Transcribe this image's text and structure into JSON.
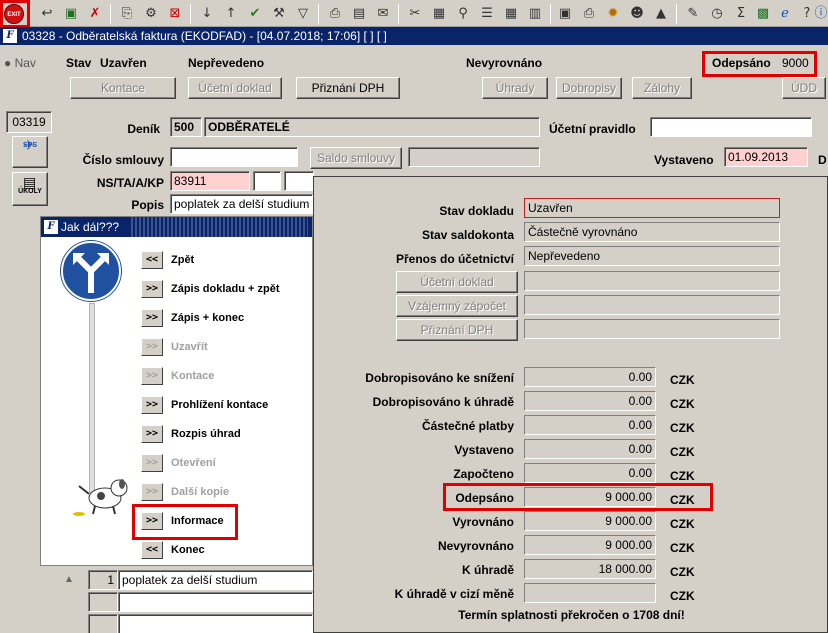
{
  "toolbar": {
    "exit_label": "EXIT",
    "icons": [
      "back-icon",
      "save-icon",
      "delete-icon",
      "copy-icon",
      "settings-icon",
      "cancel-icon",
      "sort-asc-icon",
      "sort-desc-icon",
      "check-icon",
      "wrench-icon",
      "filter-icon",
      "print-icon",
      "print-preview-icon",
      "mail-icon",
      "cut-icon",
      "paste-icon",
      "zoom-icon",
      "list-icon",
      "grid-icon",
      "calculator-icon",
      "document-icon",
      "print-small-icon",
      "gear-icon",
      "user-icon",
      "hat-icon",
      "edit-icon",
      "clock-icon",
      "sigma-icon",
      "excel-icon",
      "ie-icon",
      "help-icon",
      "info-icon"
    ]
  },
  "window": {
    "title": "03328 - Odběratelská faktura (EKODFAD) - [04.07.2018; 17:06] [ ] [ ]"
  },
  "header": {
    "nav": "Nav",
    "stav_label": "Stav",
    "stav_value": "Uzavřen",
    "neprevedeno": "Nepřevedeno",
    "nevyrovnano": "Nevyrovnáno",
    "odepsano_label": "Odepsáno",
    "odepsano_value": "9000",
    "buttons": {
      "kontace": "Kontace",
      "ucetni_doklad": "Účetní doklad",
      "priznani_dph": "Přiznání DPH",
      "uhrady": "Úhrady",
      "dobropisy": "Dobropisy",
      "zalohy": "Zálohy",
      "udd": "ÚDD"
    }
  },
  "side": {
    "code": "03319",
    "sps": "SPS",
    "ukoly": "ÚKOLY"
  },
  "form": {
    "denik_label": "Deník",
    "denik_code": "500",
    "denik_name": "ODBĚRATELÉ",
    "ucetni_pravidlo_label": "Účetní pravidlo",
    "cislo_smlouvy_label": "Číslo smlouvy",
    "saldo_smlouvy": "Saldo smlouvy",
    "vystaveno_label": "Vystaveno",
    "vystaveno_value": "01.09.2013",
    "d_label": "D",
    "ns_label": "NS/TA/A/KP",
    "ns_value": "83911",
    "popis_label": "Popis",
    "popis_value": "poplatek za delší studium"
  },
  "jak_dal": {
    "title": "Jak dál???",
    "items": [
      {
        "btn": "<<",
        "label": "Zpět",
        "enabled": true
      },
      {
        "btn": ">>",
        "label": "Zápis dokladu + zpět",
        "enabled": true
      },
      {
        "btn": ">>",
        "label": "Zápis + konec",
        "enabled": true
      },
      {
        "btn": ">>",
        "label": "Uzavřít",
        "enabled": false
      },
      {
        "btn": ">>",
        "label": "Kontace",
        "enabled": false
      },
      {
        "btn": ">>",
        "label": "Prohlížení kontace",
        "enabled": true
      },
      {
        "btn": ">>",
        "label": "Rozpis úhrad",
        "enabled": true
      },
      {
        "btn": ">>",
        "label": "Otevření",
        "enabled": false
      },
      {
        "btn": ">>",
        "label": "Další kopie",
        "enabled": false
      },
      {
        "btn": ">>",
        "label": "Informace",
        "enabled": true
      },
      {
        "btn": "<<",
        "label": "Konec",
        "enabled": true
      }
    ]
  },
  "info": {
    "stav_dokladu_label": "Stav dokladu",
    "stav_dokladu": "Uzavřen",
    "stav_saldokonta_label": "Stav saldokonta",
    "stav_saldokonta": "Částečně vyrovnáno",
    "prenos_label": "Přenos do účetnictví",
    "prenos": "Nepřevedeno",
    "btn_ucetni_doklad": "Účetní doklad",
    "btn_vzajemny_zapocet": "Vzájemný zápočet",
    "btn_priznani_dph": "Přiznání DPH",
    "currency": "CZK",
    "rows": [
      {
        "label": "Dobropisováno ke snížení",
        "value": "0.00"
      },
      {
        "label": "Dobropisováno k úhradě",
        "value": "0.00"
      },
      {
        "label": "Částečné platby",
        "value": "0.00"
      },
      {
        "label": "Vystaveno",
        "value": "0.00"
      },
      {
        "label": "Započteno",
        "value": "0.00"
      },
      {
        "label": "Odepsáno",
        "value": "9 000.00"
      },
      {
        "label": "Vyrovnáno",
        "value": "9 000.00"
      },
      {
        "label": "Nevyrovnáno",
        "value": "9 000.00"
      },
      {
        "label": "K úhradě",
        "value": "18 000.00"
      },
      {
        "label": "K úhradě v cizí měně",
        "value": ""
      }
    ],
    "termin": "Termín splatnosti překročen o 1708 dní!"
  },
  "lines": {
    "row1_num": "1",
    "row1_text": "poplatek za delší studium"
  }
}
